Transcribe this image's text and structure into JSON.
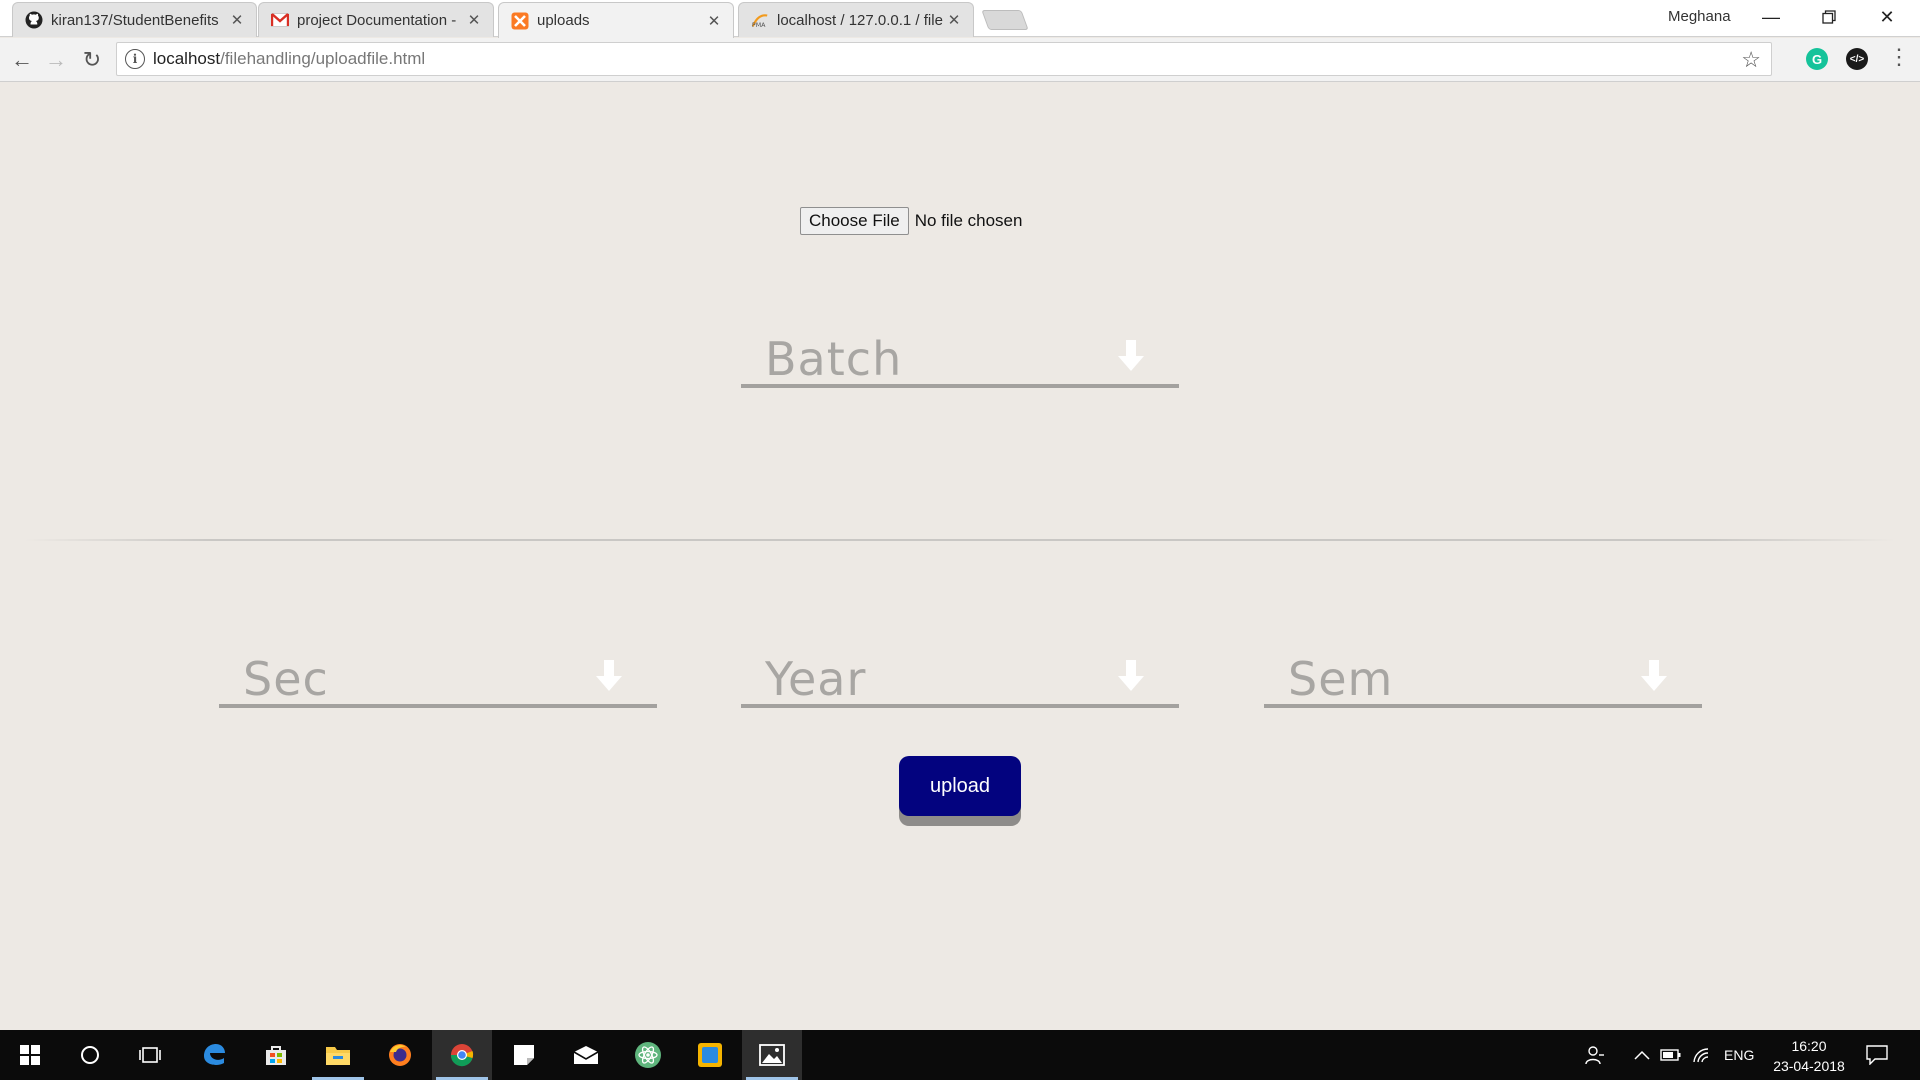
{
  "browser": {
    "tabs": [
      {
        "title": "kiran137/StudentBenefits",
        "icon": "github-icon"
      },
      {
        "title": "project Documentation -",
        "icon": "gmail-icon"
      },
      {
        "title": "uploads",
        "icon": "xampp-icon"
      },
      {
        "title": "localhost / 127.0.0.1 / file",
        "icon": "phpmyadmin-icon"
      }
    ],
    "active_tab": 2,
    "profile_name": "Meghana",
    "url_host": "localhost",
    "url_path": "/filehandling/uploadfile.html"
  },
  "form": {
    "choose_file_label": "Choose File",
    "file_status": "No file chosen",
    "batch_label": "Batch",
    "sec_label": "Sec",
    "year_label": "Year",
    "sem_label": "Sem",
    "upload_label": "upload"
  },
  "taskbar": {
    "language": "ENG",
    "time": "16:20",
    "date": "23-04-2018"
  },
  "colors": {
    "page_background": "#ede9e4",
    "upload_button": "#03037f",
    "select_underline": "#a3a19e",
    "select_text": "#a8a6a3"
  }
}
